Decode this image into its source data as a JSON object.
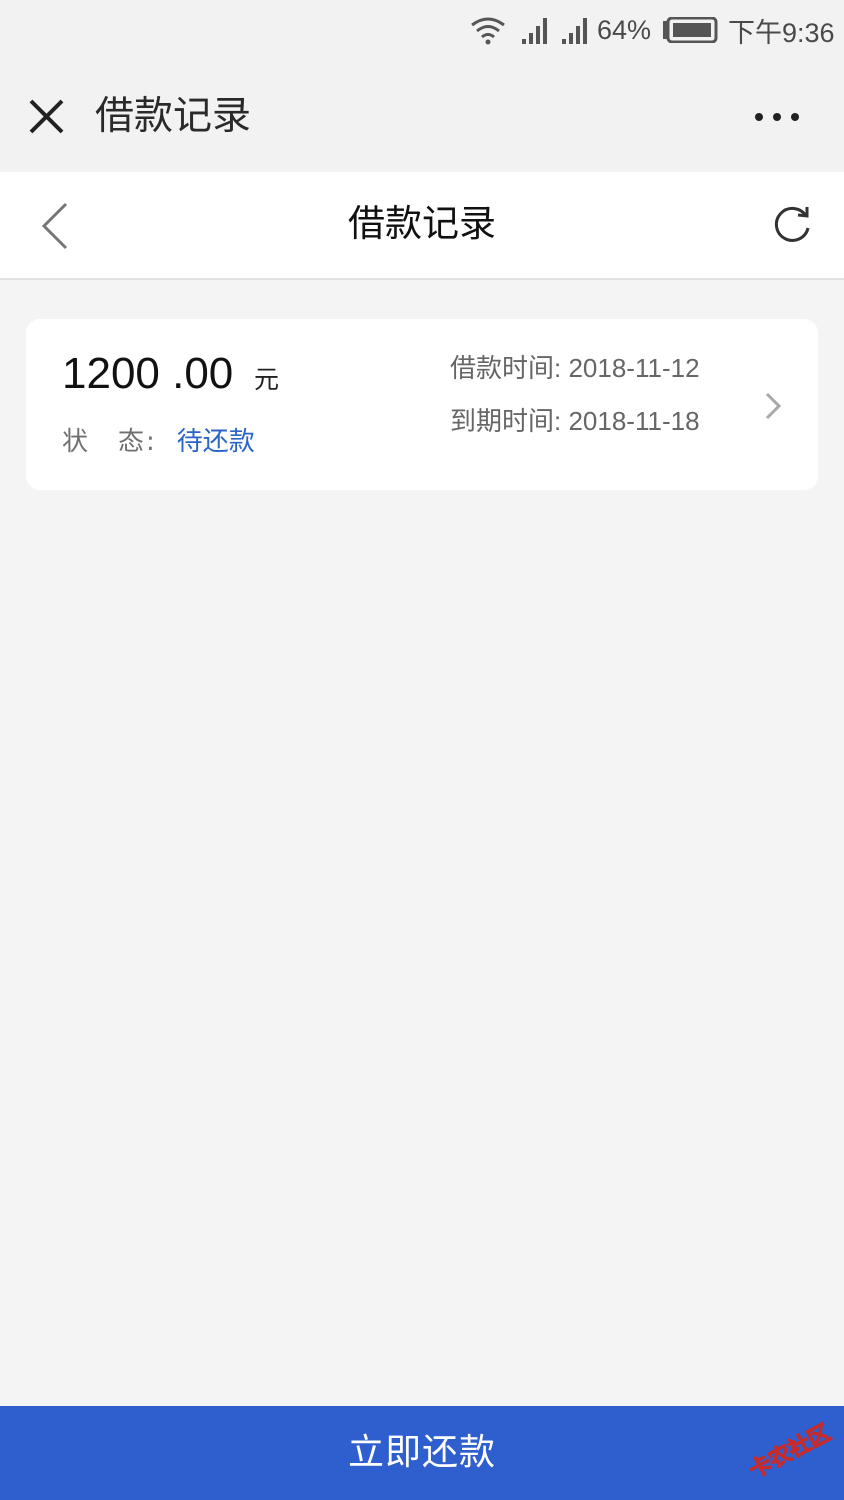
{
  "status_bar": {
    "battery": "64%",
    "time": "下午9:36"
  },
  "app_bar": {
    "title": "借款记录"
  },
  "inner_nav": {
    "title": "借款记录"
  },
  "loan_card": {
    "amount": "1200 .00",
    "unit": "元",
    "status_label": "状　态:",
    "status_value": "待还款",
    "loan_date_label": "借款时间:",
    "loan_date": "2018-11-12",
    "due_date_label": "到期时间:",
    "due_date": "2018-11-18"
  },
  "bottom_button": {
    "label": "立即还款"
  },
  "watermark": {
    "text": "卡农社区"
  },
  "colors": {
    "accent_blue": "#2f5fcf",
    "status_blue": "#2b64c7",
    "page_background": "#f4f4f4"
  }
}
